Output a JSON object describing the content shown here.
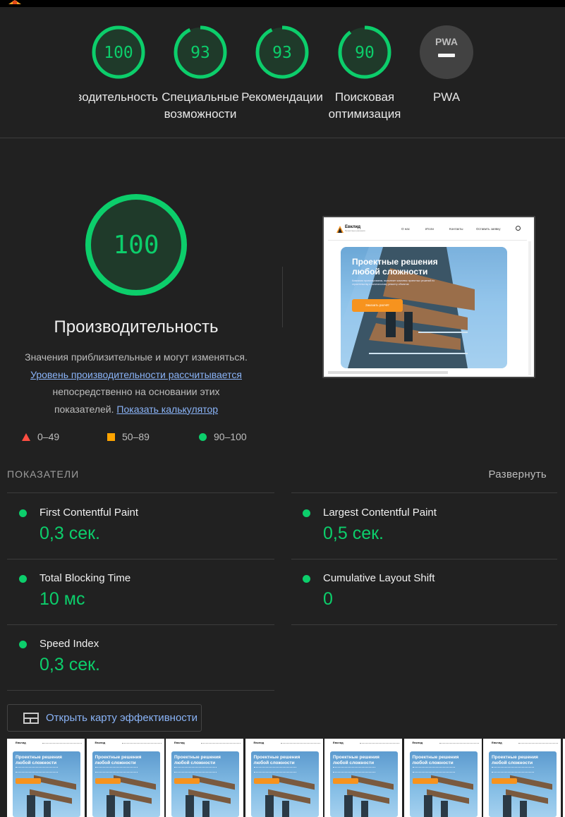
{
  "summary": {
    "gauges": [
      {
        "score": "100",
        "label": "Производительность",
        "label2": "",
        "level": 1.0
      },
      {
        "score": "93",
        "label": "Специальные",
        "label2": "возможности",
        "level": 0.93
      },
      {
        "score": "93",
        "label": "Рекомендации",
        "label2": "",
        "level": 0.93
      },
      {
        "score": "90",
        "label": "Поисковая",
        "label2": "оптимизация",
        "level": 0.9
      },
      {
        "score": "PWA",
        "label": "PWA",
        "label2": "",
        "level": 0
      }
    ]
  },
  "main": {
    "score": "100",
    "level": 1.0,
    "title": "Производительность",
    "desc_1": "Значения приблизительные и могут изменяться.",
    "desc_link_1": "Уровень производительности рассчитывается",
    "desc_2": "непосредственно на основании этих",
    "desc_3": "показателей.",
    "desc_link_2": "Показать калькулятор"
  },
  "legend": {
    "fail": "0–49",
    "average": "50–89",
    "pass": "90–100"
  },
  "preview": {
    "brand": "Евклид",
    "brand_sub": "Проектные решения",
    "nav": [
      "О нас",
      "Итоги",
      "Контакты",
      "Оставить заявку"
    ],
    "hero_title": "Проектные решения любой сложности",
    "hero_text": "Компания проектирования, выполняет комплекс проектных решений по строительству и капитальному ремонту объектов",
    "hero_button": "Заказать расчёт"
  },
  "metrics": {
    "header": "ПОКАЗАТЕЛИ",
    "expand": "Развернуть",
    "items": [
      {
        "name": "First Contentful Paint",
        "value": "0,3 сек."
      },
      {
        "name": "Largest Contentful Paint",
        "value": "0,5 сек."
      },
      {
        "name": "Total Blocking Time",
        "value": "10 мс"
      },
      {
        "name": "Cumulative Layout Shift",
        "value": "0"
      },
      {
        "name": "Speed Index",
        "value": "0,3 сек."
      }
    ]
  },
  "treemap": {
    "label": "Открыть карту эффективности"
  },
  "filmstrip": {
    "frame_title": "Проектные решения любой сложности",
    "frame_brand": "Евклид",
    "count": 8
  },
  "colors": {
    "pass": "#0cce6b",
    "average": "#ffa400",
    "fail": "#ff4e42",
    "link": "#8ab4f8",
    "background": "#212121"
  }
}
